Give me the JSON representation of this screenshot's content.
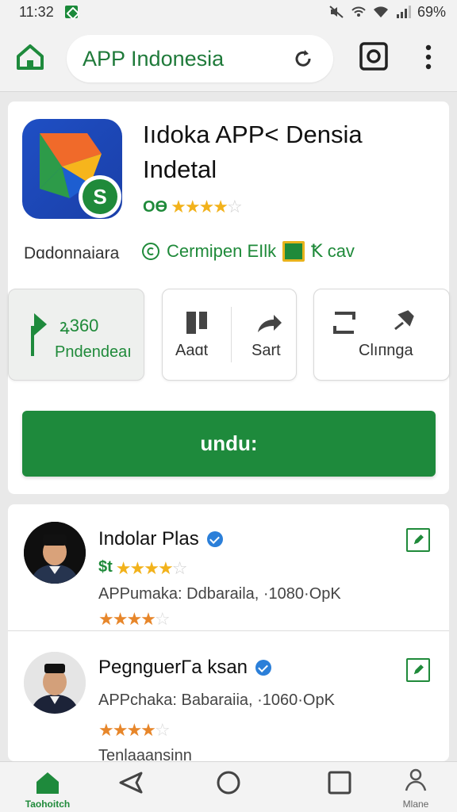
{
  "status_bar": {
    "time": "11:32",
    "battery": "69%"
  },
  "browser": {
    "url_text": "APP Indonesia"
  },
  "app": {
    "title_line1": "Iıdoka APP< Densia",
    "title_line2": "Indetal",
    "rating_prefix": "ОӨ",
    "developer": "Dɑdonnaiara",
    "meta_text1": "Cermipen EIlk",
    "meta_text2": "Ꝁ cav",
    "install_count": "ꝝ360",
    "install_label": "Pndendeaı",
    "action_add": "Aaɑt",
    "action_share": "Sart",
    "action_change": "Clıпnga",
    "download_label": "undu:"
  },
  "reviews": [
    {
      "name": "Indolar Plas",
      "rating_prefix": "$t",
      "subtitle": "APPumaka: Ddbaraila, ·1080·OpK"
    },
    {
      "name": "PegnguerΓa ksan",
      "subtitle": "APPchaka: Babaraiia, ·1060·OpK",
      "footer": "Tenlaaansinn"
    }
  ],
  "bottom_nav": {
    "home_label": "Taohoitch",
    "profile_label": "Mlane"
  },
  "colors": {
    "brand_green": "#1e8a3c",
    "star_gold": "#f2b21b",
    "star_orange": "#e7862a",
    "verified_blue": "#2b7fd9"
  }
}
